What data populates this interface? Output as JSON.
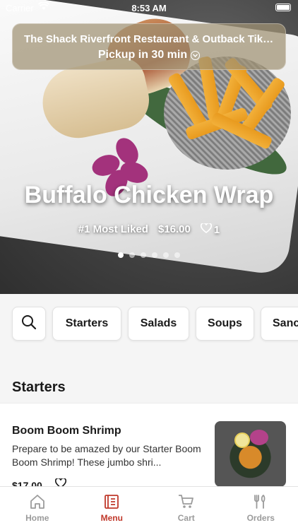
{
  "status_bar": {
    "carrier": "Carrier",
    "time": "8:53 AM"
  },
  "store": {
    "name": "The Shack Riverfront Restaurant & Outback Tiki b...",
    "pickup": "Pickup in 30 min"
  },
  "hero": {
    "title": "Buffalo Chicken Wrap",
    "rank": "#1 Most Liked",
    "price": "$16.00",
    "likes": "1",
    "carousel_total": 6,
    "carousel_active": 1
  },
  "categories": [
    "Starters",
    "Salads",
    "Soups",
    "Sanc"
  ],
  "section": {
    "title": "Starters"
  },
  "item": {
    "name": "Boom Boom Shrimp",
    "description": "Prepare to be amazed by our Starter Boom Boom Shrimp! These jumbo shri...",
    "price": "$17.00"
  },
  "tabs": [
    {
      "label": "Home",
      "icon": "home-icon",
      "active": false
    },
    {
      "label": "Menu",
      "icon": "menu-icon",
      "active": true
    },
    {
      "label": "Cart",
      "icon": "cart-icon",
      "active": false
    },
    {
      "label": "Orders",
      "icon": "orders-icon",
      "active": false
    }
  ],
  "colors": {
    "accent": "#c0392b",
    "inactive": "#9b9b9b"
  }
}
